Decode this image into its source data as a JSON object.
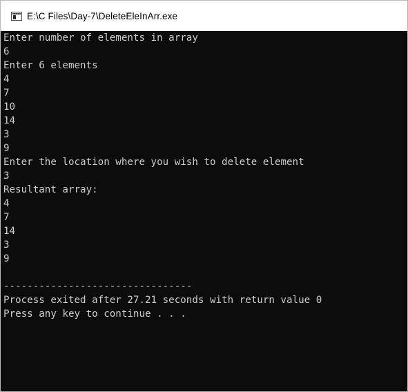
{
  "window": {
    "title": "E:\\C Files\\Day-7\\DeleteEleInArr.exe"
  },
  "console": {
    "lines": [
      "Enter number of elements in array",
      "6",
      "Enter 6 elements",
      "4",
      "7",
      "10",
      "14",
      "3",
      "9",
      "Enter the location where you wish to delete element",
      "3",
      "Resultant array:",
      "4",
      "7",
      "14",
      "3",
      "9",
      "",
      "--------------------------------",
      "Process exited after 27.21 seconds with return value 0",
      "Press any key to continue . . ."
    ]
  },
  "colors": {
    "console_background": "#0c0c0c",
    "console_text": "#cccccc",
    "titlebar_background": "#ffffff"
  }
}
